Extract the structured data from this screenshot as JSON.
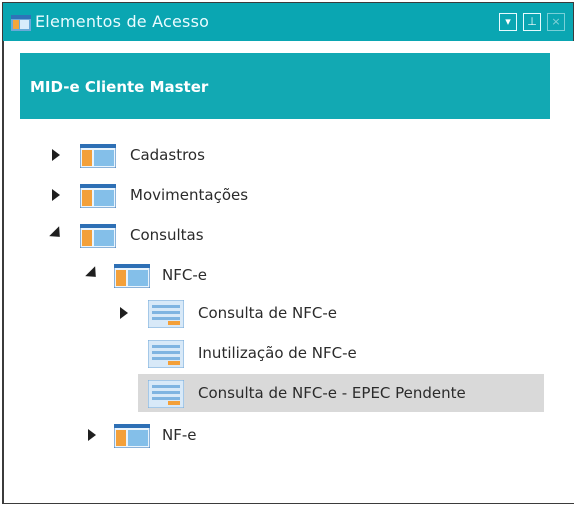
{
  "window": {
    "title": "Elementos de Acesso"
  },
  "controls": {
    "dropdown": "▾",
    "pin": "⊥",
    "close": "×"
  },
  "header": {
    "title": "MID-e Cliente Master"
  },
  "tree": {
    "items": [
      {
        "label": "Cadastros"
      },
      {
        "label": "Movimentações"
      },
      {
        "label": "Consultas"
      },
      {
        "label": "NFC-e"
      },
      {
        "label": "Consulta de NFC-e"
      },
      {
        "label": "Inutilização de NFC-e"
      },
      {
        "label": "Consulta de NFC-e - EPEC Pendente"
      },
      {
        "label": "NF-e"
      }
    ]
  },
  "colors": {
    "titlebar": "#0aa6b2",
    "header": "#12a9b3",
    "selection": "#d9d9d9"
  }
}
